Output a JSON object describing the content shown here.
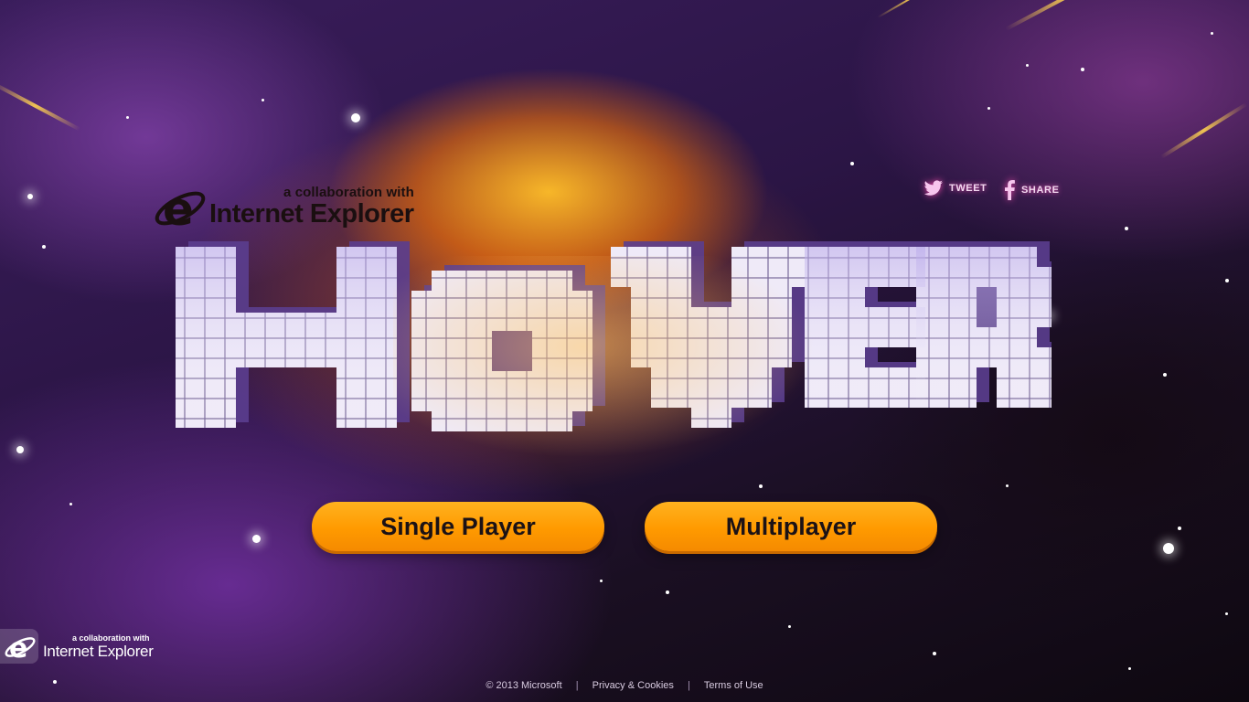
{
  "brand": {
    "collab_text": "a collaboration with",
    "partner_name": "Internet Explorer",
    "logo_icon": "internet-explorer-icon"
  },
  "social": {
    "tweet_label": "TWEET",
    "share_label": "SHARE",
    "tweet_icon": "twitter-bird-icon",
    "share_icon": "facebook-f-icon"
  },
  "game": {
    "title": "HOVER"
  },
  "menu": {
    "single_player_label": "Single Player",
    "multiplayer_label": "Multiplayer"
  },
  "footer": {
    "copyright": "© 2013 Microsoft",
    "separator": "|",
    "privacy_label": "Privacy & Cookies",
    "terms_label": "Terms of Use"
  },
  "colors": {
    "button_orange": "#ff9a00",
    "title_tile": "#ece8f6",
    "social_glow": "#ff5ab4",
    "background_purple": "#3a1d5c"
  }
}
